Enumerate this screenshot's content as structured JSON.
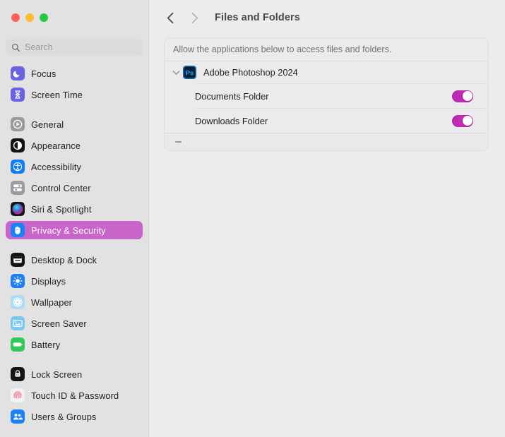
{
  "window": {
    "traffic_lights": [
      {
        "name": "close",
        "color": "#ff5f57"
      },
      {
        "name": "minimize",
        "color": "#febc2e"
      },
      {
        "name": "maximize",
        "color": "#28c840"
      }
    ]
  },
  "sidebar": {
    "search": {
      "placeholder": "Search",
      "value": "",
      "icon": "search-icon"
    },
    "selected_accent": "#c964ca",
    "groups": [
      {
        "items": [
          {
            "id": "focus",
            "label": "Focus",
            "icon": "moon-icon"
          },
          {
            "id": "screen-time",
            "label": "Screen Time",
            "icon": "hourglass-icon"
          }
        ]
      },
      {
        "items": [
          {
            "id": "general",
            "label": "General",
            "icon": "gear-settings-icon"
          },
          {
            "id": "appearance",
            "label": "Appearance",
            "icon": "contrast-circle-icon"
          },
          {
            "id": "accessibility",
            "label": "Accessibility",
            "icon": "accessibility-person-icon"
          },
          {
            "id": "control-center",
            "label": "Control Center",
            "icon": "sliders-icon"
          },
          {
            "id": "siri-spotlight",
            "label": "Siri & Spotlight",
            "icon": "siri-orb-icon"
          },
          {
            "id": "privacy-security",
            "label": "Privacy & Security",
            "icon": "open-hand-icon",
            "selected": true
          }
        ]
      },
      {
        "items": [
          {
            "id": "desktop-dock",
            "label": "Desktop & Dock",
            "icon": "dock-window-icon"
          },
          {
            "id": "displays",
            "label": "Displays",
            "icon": "brightness-sun-icon"
          },
          {
            "id": "wallpaper",
            "label": "Wallpaper",
            "icon": "flower-icon"
          },
          {
            "id": "screen-saver",
            "label": "Screen Saver",
            "icon": "screen-picture-icon"
          },
          {
            "id": "battery",
            "label": "Battery",
            "icon": "battery-icon"
          }
        ]
      },
      {
        "items": [
          {
            "id": "lock-screen",
            "label": "Lock Screen",
            "icon": "padlock-icon"
          },
          {
            "id": "touch-id",
            "label": "Touch ID & Password",
            "icon": "fingerprint-icon"
          },
          {
            "id": "users-groups",
            "label": "Users & Groups",
            "icon": "two-people-icon"
          }
        ]
      }
    ]
  },
  "toolbar": {
    "back_icon": "chevron-left-icon",
    "forward_icon": "chevron-right-icon",
    "title": "Files and Folders"
  },
  "main": {
    "panel_note": "Allow the applications below to access files and folders.",
    "apps": [
      {
        "name": "Adobe Photoshop 2024",
        "icon": "photoshop-icon",
        "icon_text": "Ps",
        "expanded": true,
        "disclosure_icon": "chevron-down-icon",
        "permissions": [
          {
            "label": "Documents Folder",
            "enabled": true
          },
          {
            "label": "Downloads Folder",
            "enabled": true
          }
        ]
      }
    ],
    "footer": {
      "remove_icon": "minus-icon"
    }
  }
}
